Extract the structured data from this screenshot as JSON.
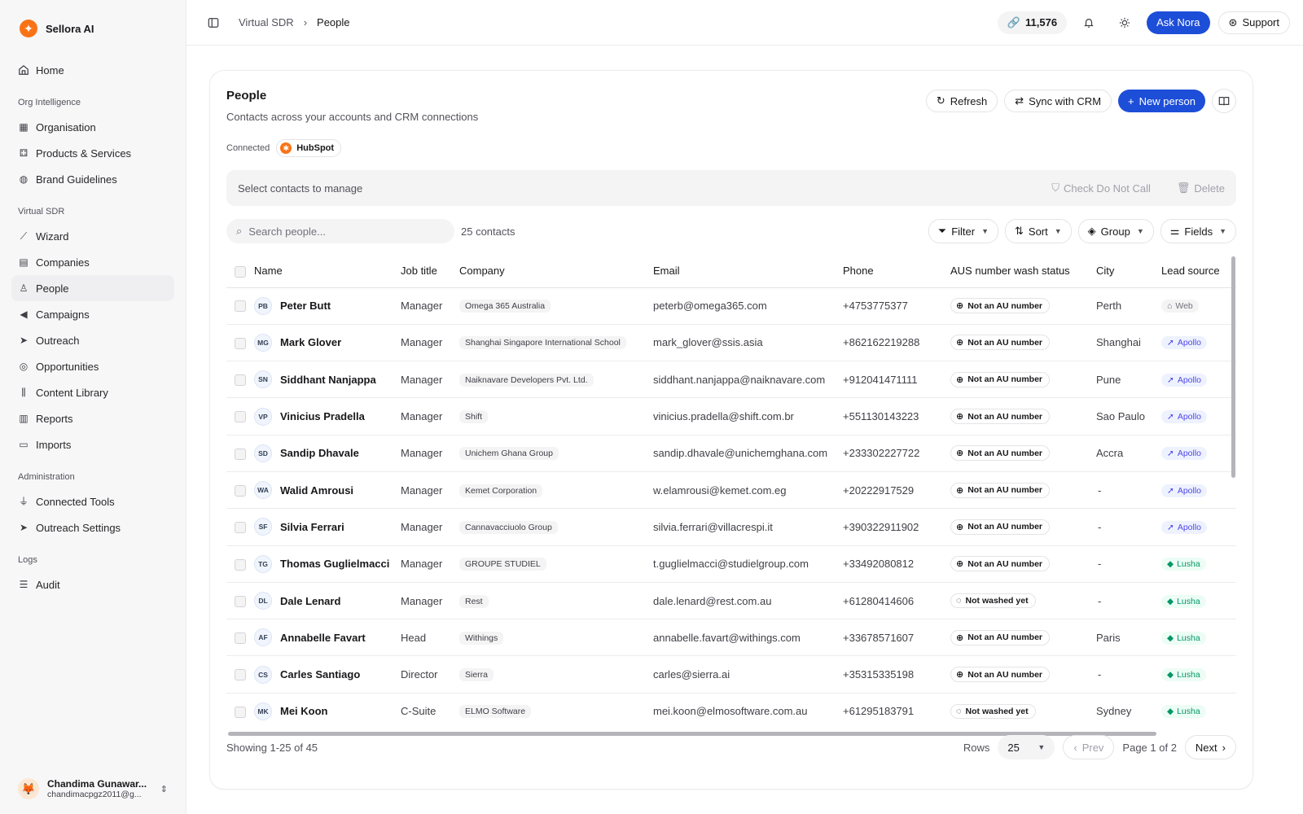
{
  "brand": {
    "name": "Sellora AI"
  },
  "sidebar": {
    "home": "Home",
    "sections": [
      {
        "title": "Org Intelligence",
        "items": [
          "Organisation",
          "Products & Services",
          "Brand Guidelines"
        ]
      },
      {
        "title": "Virtual SDR",
        "items": [
          "Wizard",
          "Companies",
          "People",
          "Campaigns",
          "Outreach",
          "Opportunities",
          "Content Library",
          "Reports",
          "Imports"
        ]
      },
      {
        "title": "Administration",
        "items": [
          "Connected Tools",
          "Outreach Settings"
        ]
      },
      {
        "title": "Logs",
        "items": [
          "Audit"
        ]
      }
    ],
    "active": "People",
    "user": {
      "name": "Chandima Gunawar...",
      "email": "chandimacpgz2011@g..."
    }
  },
  "topbar": {
    "breadcrumb_parent": "Virtual SDR",
    "breadcrumb_current": "People",
    "credits": "11,576",
    "ask_label": "Ask Nora",
    "support_label": "Support"
  },
  "page": {
    "title": "People",
    "subtitle": "Contacts across your accounts and CRM connections",
    "refresh_label": "Refresh",
    "sync_label": "Sync with CRM",
    "new_label": "New person",
    "connected_label": "Connected",
    "crm_name": "HubSpot",
    "select_hint": "Select contacts to manage",
    "dnc_label": "Check Do Not Call",
    "delete_label": "Delete",
    "search_placeholder": "Search people...",
    "contact_count": "25 contacts",
    "filter_label": "Filter",
    "sort_label": "Sort",
    "group_label": "Group",
    "fields_label": "Fields"
  },
  "table": {
    "columns": [
      "Name",
      "Job title",
      "Company",
      "Email",
      "Phone",
      "AUS number wash status",
      "City",
      "Lead source"
    ],
    "rows": [
      {
        "initials": "PB",
        "name": "Peter Butt",
        "title": "Manager",
        "company": "Omega 365 Australia",
        "email": "peterb@omega365.com",
        "phone": "+4753775377",
        "wash": "Not an AU number",
        "city": "Perth",
        "source": "Web"
      },
      {
        "initials": "MG",
        "name": "Mark Glover",
        "title": "Manager",
        "company": "Shanghai Singapore International School",
        "email": "mark_glover@ssis.asia",
        "phone": "+862162219288",
        "wash": "Not an AU number",
        "city": "Shanghai",
        "source": "Apollo"
      },
      {
        "initials": "SN",
        "name": "Siddhant Nanjappa",
        "title": "Manager",
        "company": "Naiknavare Developers Pvt. Ltd.",
        "email": "siddhant.nanjappa@naiknavare.com",
        "phone": "+912041471111",
        "wash": "Not an AU number",
        "city": "Pune",
        "source": "Apollo"
      },
      {
        "initials": "VP",
        "name": "Vinicius Pradella",
        "title": "Manager",
        "company": "Shift",
        "email": "vinicius.pradella@shift.com.br",
        "phone": "+551130143223",
        "wash": "Not an AU number",
        "city": "Sao Paulo",
        "source": "Apollo"
      },
      {
        "initials": "SD",
        "name": "Sandip Dhavale",
        "title": "Manager",
        "company": "Unichem Ghana Group",
        "email": "sandip.dhavale@unichemghana.com",
        "phone": "+233302227722",
        "wash": "Not an AU number",
        "city": "Accra",
        "source": "Apollo"
      },
      {
        "initials": "WA",
        "name": "Walid Amrousi",
        "title": "Manager",
        "company": "Kemet Corporation",
        "email": "w.elamrousi@kemet.com.eg",
        "phone": "+20222917529",
        "wash": "Not an AU number",
        "city": "-",
        "source": "Apollo"
      },
      {
        "initials": "SF",
        "name": "Silvia Ferrari",
        "title": "Manager",
        "company": "Cannavacciuolo Group",
        "email": "silvia.ferrari@villacrespi.it",
        "phone": "+390322911902",
        "wash": "Not an AU number",
        "city": "-",
        "source": "Apollo"
      },
      {
        "initials": "TG",
        "name": "Thomas Guglielmacci",
        "title": "Manager",
        "company": "GROUPE STUDIEL",
        "email": "t.guglielmacci@studielgroup.com",
        "phone": "+33492080812",
        "wash": "Not an AU number",
        "city": "-",
        "source": "Lusha"
      },
      {
        "initials": "DL",
        "name": "Dale Lenard",
        "title": "Manager",
        "company": "Rest",
        "email": "dale.lenard@rest.com.au",
        "phone": "+61280414606",
        "wash": "Not washed yet",
        "city": "-",
        "source": "Lusha"
      },
      {
        "initials": "AF",
        "name": "Annabelle Favart",
        "title": "Head",
        "company": "Withings",
        "email": "annabelle.favart@withings.com",
        "phone": "+33678571607",
        "wash": "Not an AU number",
        "city": "Paris",
        "source": "Lusha"
      },
      {
        "initials": "CS",
        "name": "Carles Santiago",
        "title": "Director",
        "company": "Sierra",
        "email": "carles@sierra.ai",
        "phone": "+35315335198",
        "wash": "Not an AU number",
        "city": "-",
        "source": "Lusha"
      },
      {
        "initials": "MK",
        "name": "Mei Koon",
        "title": "C-Suite",
        "company": "ELMO Software",
        "email": "mei.koon@elmosoftware.com.au",
        "phone": "+61295183791",
        "wash": "Not washed yet",
        "city": "Sydney",
        "source": "Lusha"
      }
    ]
  },
  "footer": {
    "showing": "Showing 1-25 of 45",
    "rows_label": "Rows",
    "rows_value": "25",
    "prev_label": "Prev",
    "page_label": "Page 1 of 2",
    "next_label": "Next"
  },
  "colors": {
    "primary": "#1d4ed8",
    "brand": "#f97316",
    "apollo": "#4f46e5",
    "lusha": "#059669"
  }
}
